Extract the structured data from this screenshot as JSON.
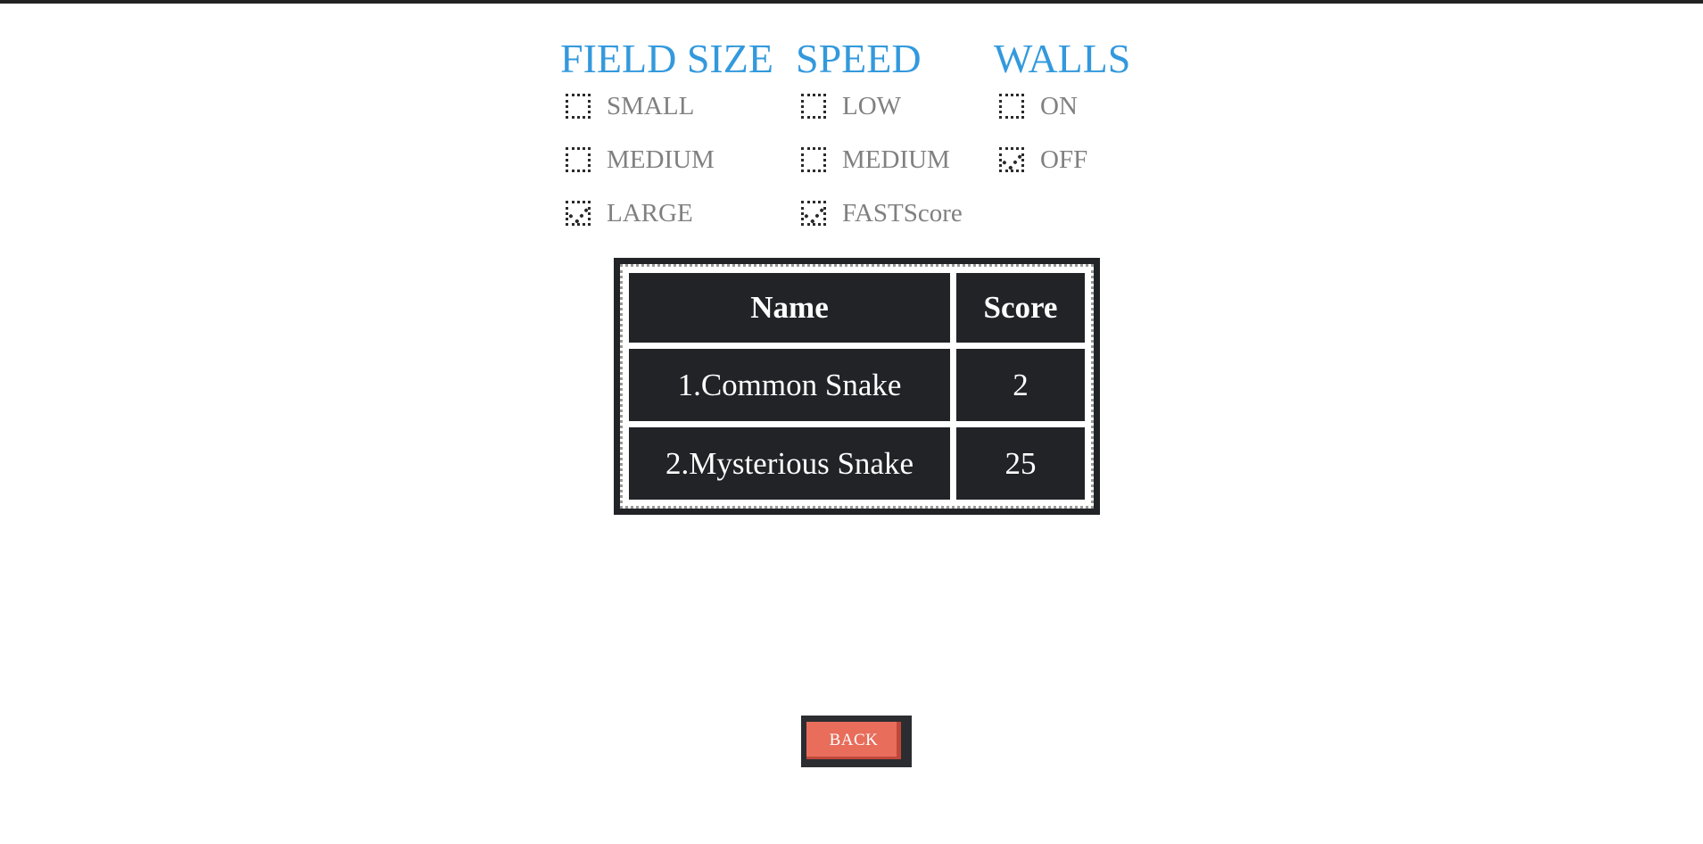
{
  "settings": {
    "field_size": {
      "title": "FIELD SIZE",
      "options": [
        {
          "label": "SMALL",
          "checked": false
        },
        {
          "label": "MEDIUM",
          "checked": false
        },
        {
          "label": "LARGE",
          "checked": true
        }
      ]
    },
    "speed": {
      "title": "SPEED",
      "options": [
        {
          "label": "LOW",
          "checked": false
        },
        {
          "label": "MEDIUM",
          "checked": false
        },
        {
          "label": "FAST",
          "checked": true
        }
      ],
      "trailing_text": "Score"
    },
    "walls": {
      "title": "WALLS",
      "options": [
        {
          "label": "ON",
          "checked": false
        },
        {
          "label": "OFF",
          "checked": true
        }
      ]
    }
  },
  "scoreboard": {
    "headers": {
      "name": "Name",
      "score": "Score"
    },
    "rows": [
      {
        "name": "1.Common Snake",
        "score": "2"
      },
      {
        "name": "2.Mysterious Snake",
        "score": "25"
      }
    ]
  },
  "back_button": {
    "label": "BACK"
  },
  "colors": {
    "heading": "#3399dd",
    "option_text": "#808080",
    "table_bg": "#212327",
    "back_button": "#e86d5b"
  }
}
